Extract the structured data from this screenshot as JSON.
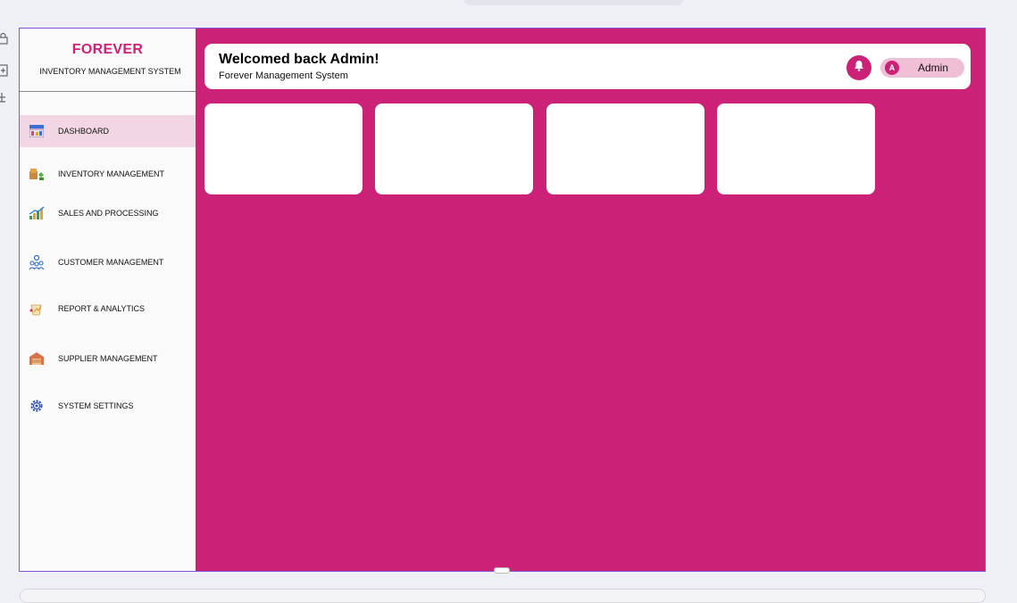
{
  "brand": {
    "title": "FOREVER",
    "subtitle": "INVENTORY MANAGEMENT SYSTEM"
  },
  "sidebar": {
    "items": [
      {
        "label": "DASHBOARD",
        "icon": "dashboard-icon",
        "active": true
      },
      {
        "label": "INVENTORY MANAGEMENT",
        "icon": "inventory-icon",
        "active": false
      },
      {
        "label": "SALES AND PROCESSING",
        "icon": "sales-chart-icon",
        "active": false
      },
      {
        "label": "CUSTOMER MANAGEMENT",
        "icon": "customers-icon",
        "active": false
      },
      {
        "label": "REPORT & ANALYTICS",
        "icon": "report-icon",
        "active": false
      },
      {
        "label": "SUPPLIER MANAGEMENT",
        "icon": "supplier-icon",
        "active": false
      },
      {
        "label": "SYSTEM SETTINGS",
        "icon": "gear-icon",
        "active": false
      }
    ]
  },
  "header": {
    "welcome": "Welcomed back Admin!",
    "subtitle": "Forever Management System",
    "user_initial": "A",
    "user_name": "Admin"
  },
  "colors": {
    "accent": "#cb2278",
    "sidebar_bg": "#fafafa",
    "active_item_bg": "#f2d6e4",
    "user_chip_bg": "#efbfd6"
  }
}
